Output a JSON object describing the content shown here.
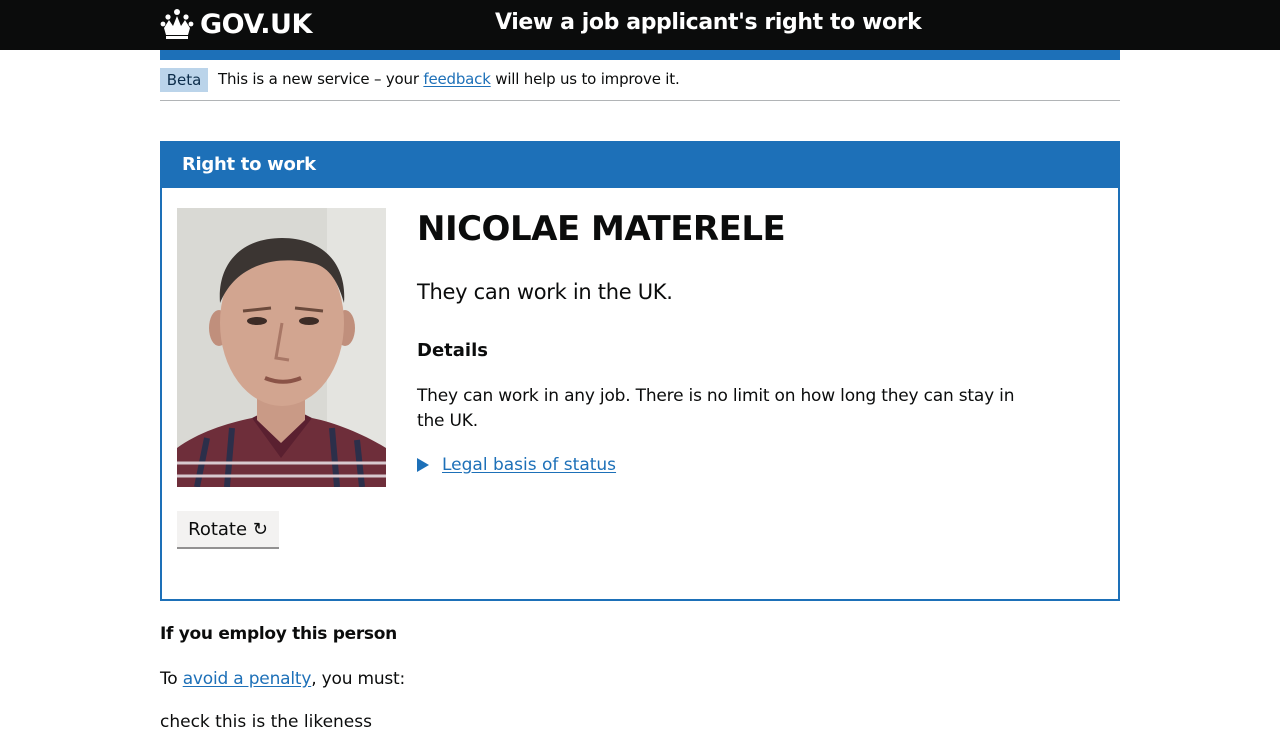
{
  "header": {
    "logo_text": "GOV.UK",
    "service_name": "View a job applicant's right to work"
  },
  "phase_banner": {
    "tag": "Beta",
    "text_before": "This is a new service – your ",
    "link_text": "feedback",
    "text_after": " will help us to improve it."
  },
  "panel": {
    "heading": "Right to work",
    "rotate_button_label": "Rotate ↻",
    "name": "NICOLAE MATERELE",
    "status": "They can work in the UK.",
    "details_heading": "Details",
    "details_text": "They can work in any job. There is no limit on how long they can stay in the UK.",
    "legal_basis_link": "Legal basis of status"
  },
  "employ": {
    "heading": "If you employ this person",
    "text_before": "To ",
    "link_text": "avoid a penalty",
    "text_after": ", you must:",
    "cutoff_line": "check this is the likeness"
  },
  "colors": {
    "header_bg": "#0b0c0c",
    "brand_blue": "#1d70b8",
    "phase_tag_bg": "#bbd4ea",
    "button_bg": "#f3f2f1"
  }
}
